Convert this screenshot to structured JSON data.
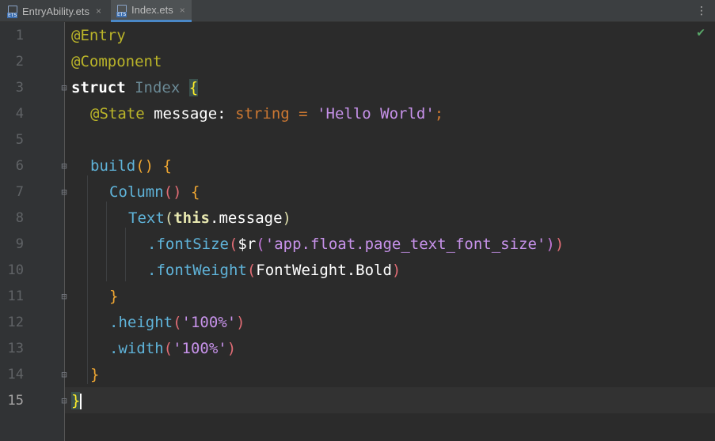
{
  "tabs": [
    {
      "label": "EntryAbility.ets",
      "close": "×",
      "active": false
    },
    {
      "label": "Index.ets",
      "close": "×",
      "active": true
    }
  ],
  "menu_icon": "⋮",
  "inspection_icon": "✔",
  "line_numbers": [
    "1",
    "2",
    "3",
    "4",
    "5",
    "6",
    "7",
    "8",
    "9",
    "10",
    "11",
    "12",
    "13",
    "14",
    "15"
  ],
  "code": {
    "l1": {
      "ann": "@Entry"
    },
    "l2": {
      "ann": "@Component"
    },
    "l3": {
      "kw": "struct",
      "name": "Index",
      "brace": "{"
    },
    "l4": {
      "ann": "@State",
      "name": "message",
      "colon": ":",
      "type": "string",
      "eq": "=",
      "value": "'Hello World'",
      "semi": ";"
    },
    "l6": {
      "fn": "build",
      "parens": "()",
      "brace": "{"
    },
    "l7": {
      "fn": "Column",
      "parens": "()",
      "brace": "{"
    },
    "l8": {
      "fn": "Text",
      "open": "(",
      "this": "this",
      "dot": ".",
      "prop": "message",
      "close": ")"
    },
    "l9": {
      "method": ".fontSize",
      "open": "(",
      "res": "$r",
      "open2": "(",
      "arg": "'app.float.page_text_font_size'",
      "close2": ")",
      "close": ")"
    },
    "l10": {
      "method": ".fontWeight",
      "open": "(",
      "enum": "FontWeight",
      "dot": ".",
      "member": "Bold",
      "close": ")"
    },
    "l11": {
      "brace": "}"
    },
    "l12": {
      "method": ".height",
      "open": "(",
      "arg": "'100%'",
      "close": ")"
    },
    "l13": {
      "method": ".width",
      "open": "(",
      "arg": "'100%'",
      "close": ")"
    },
    "l14": {
      "brace": "}"
    },
    "l15": {
      "brace": "}"
    }
  },
  "colors": {
    "background": "#2b2b2b",
    "gutter": "#313335",
    "tab_active_underline": "#4a88c7",
    "annotation": "#bbb529"
  }
}
